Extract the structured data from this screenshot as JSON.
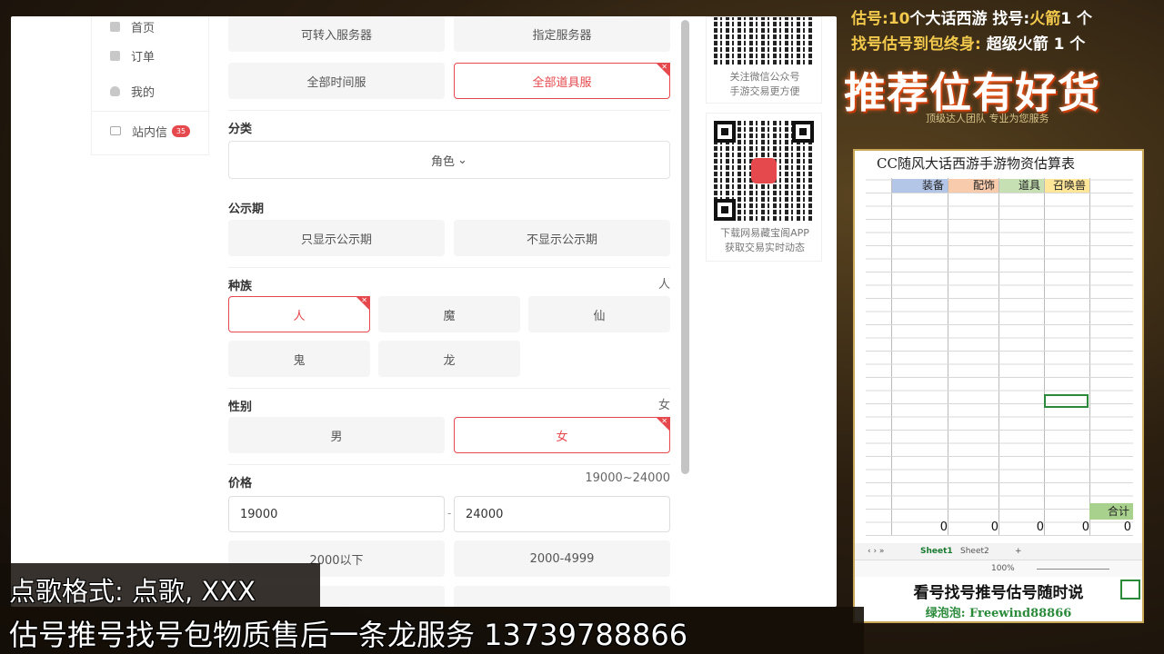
{
  "sidebar": {
    "items": [
      {
        "label": "首页",
        "icon": "home-icon"
      },
      {
        "label": "订单",
        "icon": "order-icon"
      },
      {
        "label": "我的",
        "icon": "user-icon"
      },
      {
        "label": "站内信",
        "icon": "mail-icon",
        "badge": "35"
      }
    ]
  },
  "filters": {
    "server_opts": [
      "可转入服务器",
      "指定服务器",
      "全部时间服",
      "全部道具服"
    ],
    "category": {
      "title": "分类",
      "selected": "角色"
    },
    "publicity": {
      "title": "公示期",
      "opts": [
        "只显示公示期",
        "不显示公示期"
      ]
    },
    "race": {
      "title": "种族",
      "value": "人",
      "opts": [
        "人",
        "魔",
        "仙",
        "鬼",
        "龙"
      ]
    },
    "gender": {
      "title": "性别",
      "value": "女",
      "opts": [
        "男",
        "女"
      ]
    },
    "price": {
      "title": "价格",
      "value": "19000~24000",
      "min": "19000",
      "max": "24000",
      "dash": "-",
      "opts": [
        "2000以下",
        "2000-4999"
      ]
    }
  },
  "qr_cards": [
    {
      "line1": "关注微信公众号",
      "line2": "手游交易更方便"
    },
    {
      "line1": "下载网易藏宝阁APP",
      "line2": "获取交易实时动态"
    }
  ],
  "overlay": {
    "promo1_a": "估号:",
    "promo1_b": "10",
    "promo1_c": "个大话西游 找号:",
    "promo1_d": "火箭",
    "promo1_e": "1 个",
    "promo2_a": "找号估号到包终身:",
    "promo2_b": "超级火箭 1 个",
    "slogan": "推荐位有好货",
    "tiny": "顶级达人团队 专业为您服务",
    "song_format": "点歌格式: 点歌, XXX",
    "service_line": "估号推号找号包物质售后一条龙服务 13739788866"
  },
  "sheet": {
    "title": "CC随风大话西游手游物资估算表",
    "headers": [
      "装备",
      "配饰",
      "道具",
      "召唤兽"
    ],
    "header_colors": [
      "#b4c6e7",
      "#f8cbad",
      "#c6e0b4",
      "#ffe699"
    ],
    "sum_label": "合计",
    "sums": [
      "0",
      "0",
      "0",
      "0",
      "0"
    ],
    "tabs": [
      "Sheet1",
      "Sheet2"
    ],
    "zoom": "100%",
    "foot1": "看号找号推号估号随时说",
    "foot2": "绿泡泡: Freewind88866"
  }
}
